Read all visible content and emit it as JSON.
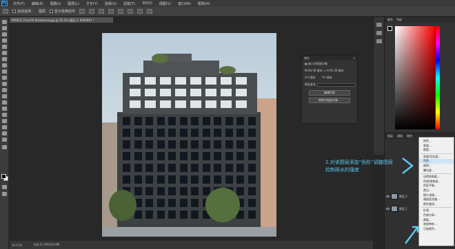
{
  "menubar": {
    "logo": "Ps",
    "items": [
      "文件(F)",
      "编辑(E)",
      "图像(I)",
      "图层(L)",
      "文字(Y)",
      "选择(S)",
      "滤镜(T)",
      "3D(D)",
      "视图(V)",
      "窗口(W)",
      "帮助(H)"
    ]
  },
  "options": {
    "auto_select": "自动选择：",
    "layer_select": "图层",
    "show_transform": "显示变换控件"
  },
  "document": {
    "tab": "MARCH_Final-03-Streetview.jpg @ 34.1% (图层 2, RGB/8#) *",
    "zoom": "34.11%",
    "doc_size": "文档:27.4M/159.8M"
  },
  "properties": {
    "tab": "属性",
    "title": "嵌入的智能对象",
    "w_label": "W:",
    "w_value": "60.98 厘米",
    "h_label": "H:",
    "h_value": "91.58 厘米",
    "x_label": "X:",
    "x_value": "0 厘米",
    "y_label": "Y:",
    "y_value": "0 厘米",
    "layer_comp": "图层复合",
    "btn_edit": "编辑内容",
    "btn_convert": "转换为链接对象..."
  },
  "color_panel": {
    "tabs": [
      "颜色",
      "色板"
    ]
  },
  "layers_panel": {
    "tabs": [
      "图层",
      "通道",
      "路径"
    ],
    "layer_1": "图层 2",
    "layer_2": "图层 1"
  },
  "context_menu": {
    "items": [
      "纯色...",
      "渐变...",
      "图案...",
      "亮度/对比度...",
      "色阶...",
      "曲线...",
      "曝光度...",
      "自然饱和度...",
      "色相/饱和度...",
      "色彩平衡...",
      "黑白...",
      "照片滤镜...",
      "通道混合器...",
      "颜色查找...",
      "反相",
      "色调分离...",
      "阈值...",
      "渐变映射...",
      "可选颜色..."
    ],
    "highlight_index": 4
  },
  "annotation": {
    "line1": "2.对该图层添加“色阶”调整图层",
    "line2": "控制雨水的强度"
  },
  "colors": {
    "annotation": "#5cc8ee",
    "highlight": "#cfe4f7"
  }
}
